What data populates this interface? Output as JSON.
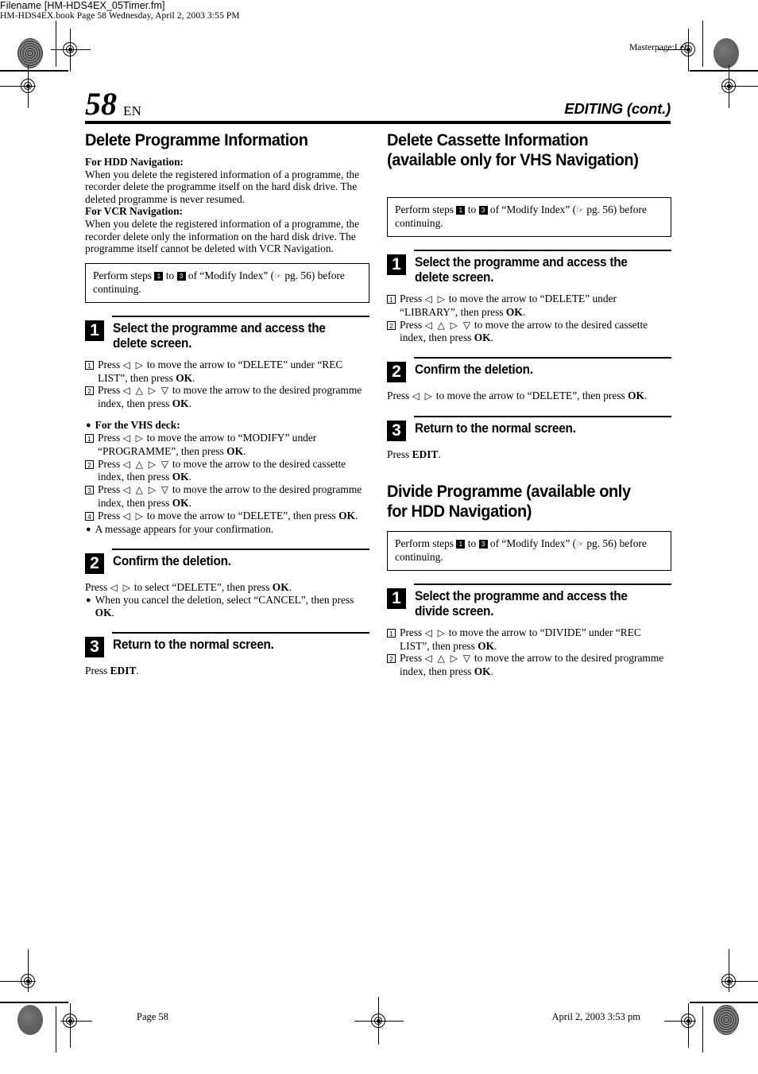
{
  "frontmatter": {
    "filename_line": "Filename [HM-HDS4EX_05Timer.fm]",
    "book_line": "HM-HDS4EX.book  Page 58  Wednesday, April 2, 2003  3:55 PM",
    "masterpage": "Masterpage:Left"
  },
  "header": {
    "page_number": "58",
    "language": "EN",
    "chapter": "EDITING (cont.)"
  },
  "left_column": {
    "section_title": "Delete Programme Information",
    "intro": [
      {
        "label": "For HDD Navigation:",
        "text": "When you delete the registered information of a programme, the recorder delete the programme itself on the hard disk drive. The deleted programme is never resumed."
      },
      {
        "label": "For VCR Navigation:",
        "text": "When you delete the registered information of a programme, the recorder delete only the information on the hard disk drive. The programme itself cannot be deleted with VCR Navigation."
      }
    ],
    "callout": {
      "prefix": "Perform steps",
      "step_from": "1",
      "mid": "to",
      "step_to": "3",
      "suffix": "of “Modify Index” (",
      "hand": "☞",
      "page_ref": "pg. 56) before continuing."
    },
    "steps": [
      {
        "num": "1",
        "title": "Select the programme and access the delete screen.",
        "substeps": [
          {
            "num": "1",
            "pre": "Press",
            "arrows": "◁ ▷",
            "mid": "to move the arrow to “DELETE” under “REC LIST”, then press ",
            "bold": "OK",
            "post": "."
          },
          {
            "num": "2",
            "pre": "Press",
            "arrows": "◁ △ ▷ ▽",
            "mid": "to move the arrow to the desired programme index, then press ",
            "bold": "OK",
            "post": "."
          }
        ],
        "sub_heading": "For the VHS deck:",
        "substeps2": [
          {
            "num": "1",
            "pre": "Press",
            "arrows": "◁ ▷",
            "mid": "to move the arrow to “MODIFY” under “PROGRAMME”, then press ",
            "bold": "OK",
            "post": "."
          },
          {
            "num": "2",
            "pre": "Press",
            "arrows": "◁ △ ▷ ▽",
            "mid": "to move the arrow to the desired cassette index, then press ",
            "bold": "OK",
            "post": "."
          },
          {
            "num": "3",
            "pre": "Press",
            "arrows": "◁ △ ▷ ▽",
            "mid": "to move the arrow to the desired programme index, then press ",
            "bold": "OK",
            "post": "."
          },
          {
            "num": "4",
            "pre": "Press",
            "arrows": "◁ ▷",
            "mid": "to move the arrow to “DELETE”, then press ",
            "bold": "OK",
            "post": "."
          }
        ],
        "note": "A message appears for your confirmation."
      },
      {
        "num": "2",
        "title": "Confirm the deletion.",
        "line_pre": "Press",
        "line_arrows": "◁ ▷",
        "line_mid": "to select “DELETE”, then press ",
        "line_bold": "OK",
        "line_post": ".",
        "note_pre": "When you cancel the deletion, select “CANCEL”, then press ",
        "note_bold": "OK",
        "note_post": "."
      },
      {
        "num": "3",
        "title": "Return to the normal screen.",
        "line_pre": "Press ",
        "line_bold": "EDIT",
        "line_post": "."
      }
    ]
  },
  "right_column": {
    "section1_title": "Delete Cassette Information (available only for VHS Navigation)",
    "callout1": {
      "prefix": "Perform steps",
      "step_from": "1",
      "mid": "to",
      "step_to": "3",
      "suffix": "of “Modify Index” (",
      "hand": "☞",
      "page_ref": "pg. 56) before continuing."
    },
    "steps1": [
      {
        "num": "1",
        "title": "Select the programme and access the delete screen.",
        "substeps": [
          {
            "num": "1",
            "pre": "Press",
            "arrows": "◁ ▷",
            "mid": "to move the arrow to “DELETE” under “LIBRARY”, then press ",
            "bold": "OK",
            "post": "."
          },
          {
            "num": "2",
            "pre": "Press",
            "arrows": "◁ △ ▷ ▽",
            "mid": "to move the arrow to the desired cassette index, then press ",
            "bold": "OK",
            "post": "."
          }
        ]
      },
      {
        "num": "2",
        "title": "Confirm the deletion.",
        "line_pre": "Press",
        "line_arrows": "◁ ▷",
        "line_mid": "to move the arrow to “DELETE”, then press ",
        "line_bold": "OK",
        "line_post": "."
      },
      {
        "num": "3",
        "title": "Return to the normal screen.",
        "line_pre": "Press ",
        "line_bold": "EDIT",
        "line_post": "."
      }
    ],
    "section2_title": "Divide Programme (available only for HDD Navigation)",
    "callout2": {
      "prefix": "Perform steps",
      "step_from": "1",
      "mid": "to",
      "step_to": "3",
      "suffix": "of “Modify Index” (",
      "hand": "☞",
      "page_ref": "pg. 56) before continuing."
    },
    "steps2": [
      {
        "num": "1",
        "title": "Select the programme and access the divide screen.",
        "substeps": [
          {
            "num": "1",
            "pre": "Press",
            "arrows": "◁ ▷",
            "mid": "to move the arrow to “DIVIDE” under “REC LIST”, then press ",
            "bold": "OK",
            "post": "."
          },
          {
            "num": "2",
            "pre": "Press",
            "arrows": "◁ △ ▷ ▽",
            "mid": "to move the arrow to the desired programme index, then press ",
            "bold": "OK",
            "post": "."
          }
        ]
      }
    ]
  },
  "footer": {
    "page_label": "Page 58",
    "date_label": "April 2, 2003 3:53 pm"
  }
}
